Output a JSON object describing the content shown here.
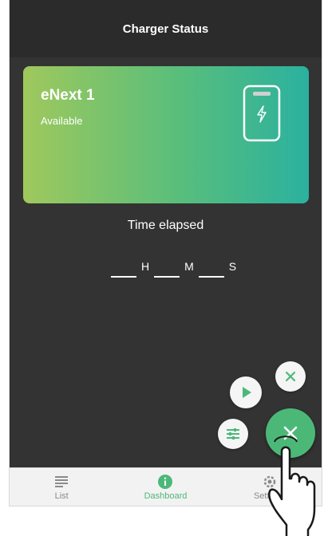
{
  "header": {
    "title": "Charger Status"
  },
  "charger_card": {
    "name": "eNext 1",
    "status": "Available"
  },
  "timer": {
    "label": "Time elapsed",
    "hours_unit": "H",
    "minutes_unit": "M",
    "seconds_unit": "S"
  },
  "nav": {
    "items": [
      {
        "label": "List",
        "icon": "list-icon"
      },
      {
        "label": "Dashboard",
        "icon": "info-icon"
      },
      {
        "label": "Settings",
        "icon": "settings-icon"
      }
    ],
    "active": "Dashboard"
  },
  "colors": {
    "accent": "#4cb878",
    "background": "#333333",
    "card_start": "#9fc85c",
    "card_end": "#2bb19f"
  }
}
